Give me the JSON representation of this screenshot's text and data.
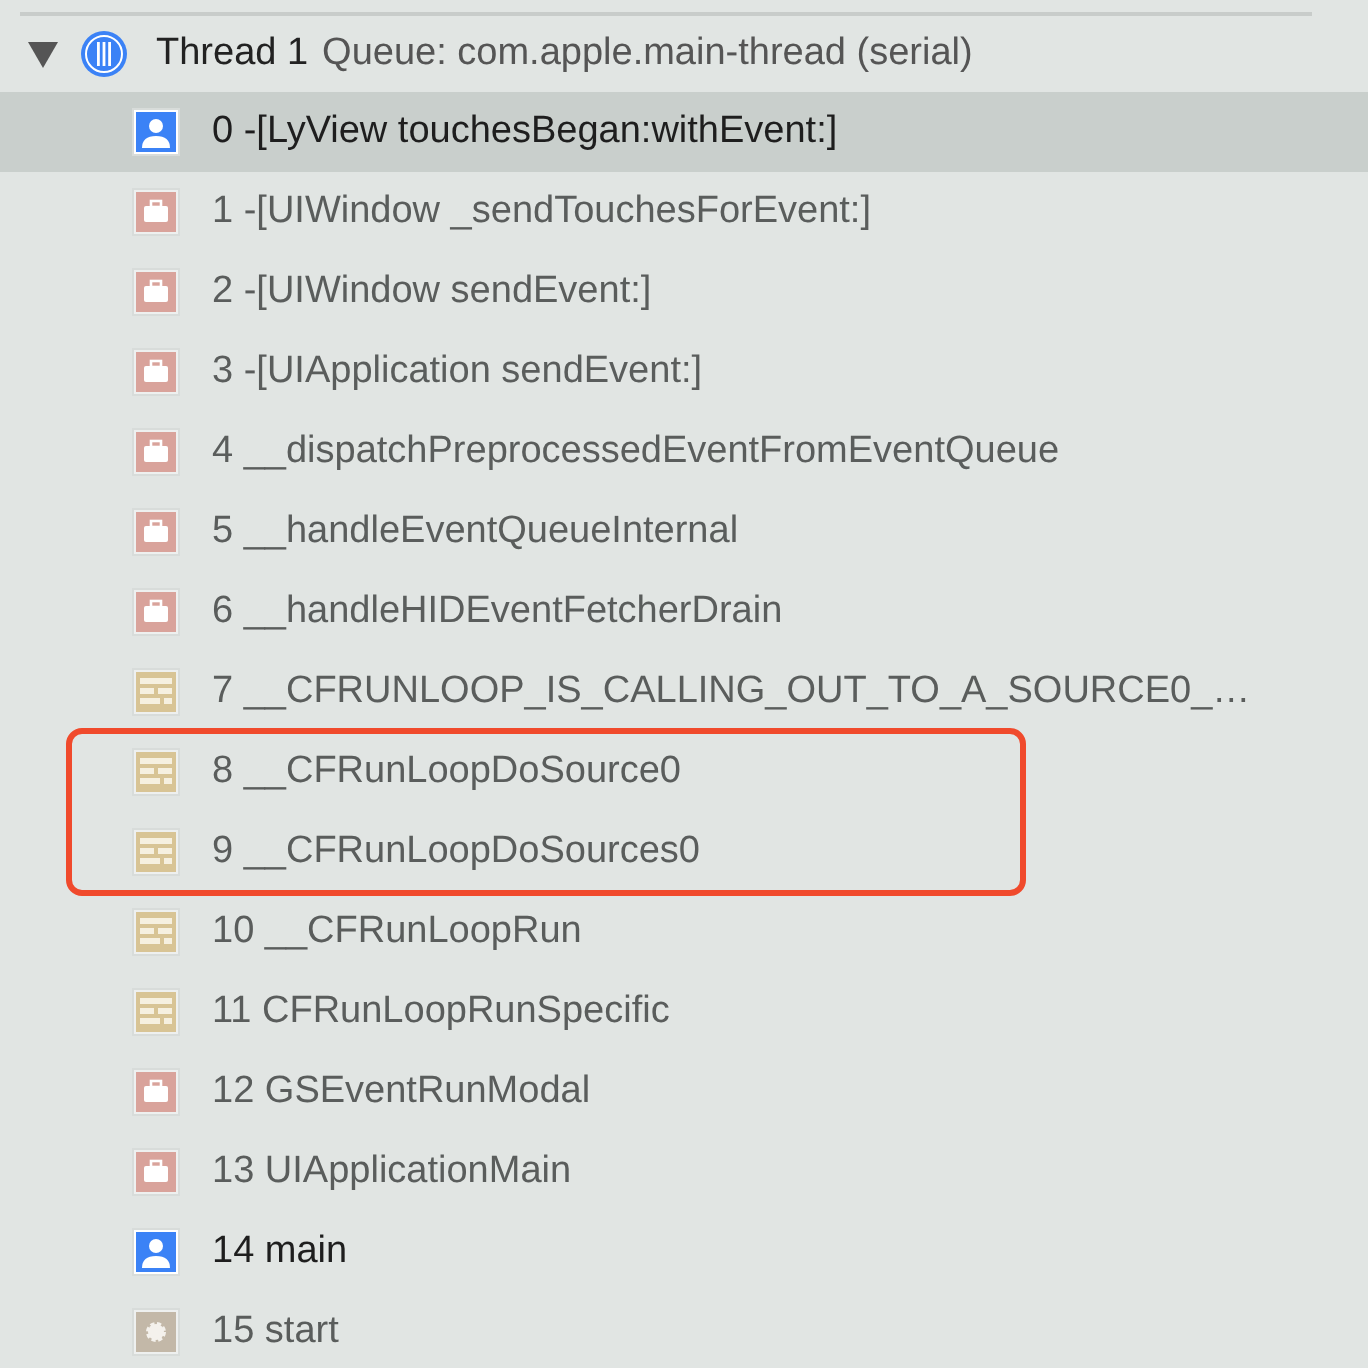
{
  "thread": {
    "expanded": true,
    "title": "Thread 1",
    "queue": "Queue: com.apple.main-thread (serial)"
  },
  "frames": [
    {
      "label": "0 -[LyView touchesBegan:withEvent:]",
      "kind": "user",
      "selected": true,
      "highlighted": false
    },
    {
      "label": "1 -[UIWindow _sendTouchesForEvent:]",
      "kind": "framework",
      "selected": false,
      "highlighted": false
    },
    {
      "label": "2 -[UIWindow sendEvent:]",
      "kind": "framework",
      "selected": false,
      "highlighted": false
    },
    {
      "label": "3 -[UIApplication sendEvent:]",
      "kind": "framework",
      "selected": false,
      "highlighted": false
    },
    {
      "label": "4 __dispatchPreprocessedEventFromEventQueue",
      "kind": "framework",
      "selected": false,
      "highlighted": false
    },
    {
      "label": "5 __handleEventQueueInternal",
      "kind": "framework",
      "selected": false,
      "highlighted": false
    },
    {
      "label": "6 __handleHIDEventFetcherDrain",
      "kind": "framework",
      "selected": false,
      "highlighted": false
    },
    {
      "label": "7 __CFRUNLOOP_IS_CALLING_OUT_TO_A_SOURCE0_…",
      "kind": "system",
      "selected": false,
      "highlighted": false
    },
    {
      "label": "8 __CFRunLoopDoSource0",
      "kind": "system",
      "selected": false,
      "highlighted": true
    },
    {
      "label": "9 __CFRunLoopDoSources0",
      "kind": "system",
      "selected": false,
      "highlighted": true
    },
    {
      "label": "10 __CFRunLoopRun",
      "kind": "system",
      "selected": false,
      "highlighted": false
    },
    {
      "label": "11 CFRunLoopRunSpecific",
      "kind": "system",
      "selected": false,
      "highlighted": false
    },
    {
      "label": "12 GSEventRunModal",
      "kind": "framework",
      "selected": false,
      "highlighted": false
    },
    {
      "label": "13 UIApplicationMain",
      "kind": "framework",
      "selected": false,
      "highlighted": false
    },
    {
      "label": "14 main",
      "kind": "user",
      "selected": false,
      "highlighted": false
    },
    {
      "label": "15 start",
      "kind": "other",
      "selected": false,
      "highlighted": false
    }
  ]
}
